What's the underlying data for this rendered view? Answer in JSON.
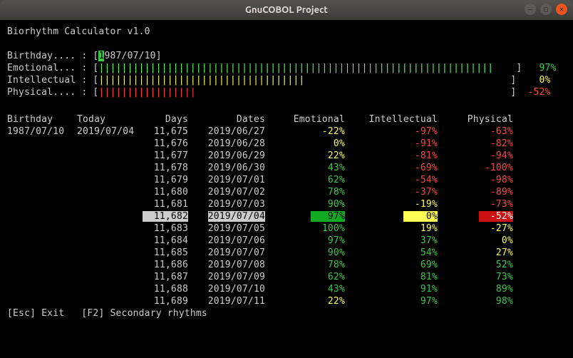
{
  "window": {
    "title": "GnuCOBOL Project"
  },
  "app": {
    "title": "Biorhythm Calculator v1.0"
  },
  "input": {
    "birthday_label": "Birthday.... : [",
    "birthday_cursor": "1",
    "birthday_rest": "987/07/10]"
  },
  "summary_bars": [
    {
      "label": "Emotional... : [",
      "color": "brightgreen",
      "count": 69,
      "close": " ]",
      "value": "97%",
      "valclass": "green"
    },
    {
      "label": "Intellectual : [",
      "color": "yellow",
      "count": 36,
      "close": "]",
      "value": "0%",
      "valclass": "yellow"
    },
    {
      "label": "Physical.... : [",
      "color": "red",
      "count": 17,
      "close": "]",
      "value": "-52%",
      "valclass": "red"
    }
  ],
  "headers": {
    "birthday": "Birthday",
    "today": "Today",
    "days": "Days",
    "dates": "Dates",
    "emotional": "Emotional",
    "intellectual": "Intellectual",
    "physical": "Physical"
  },
  "meta": {
    "birthday": "1987/07/10",
    "today": "2019/07/04"
  },
  "rows": [
    {
      "days": "11,675",
      "date": "2019/06/27",
      "emo": "-22%",
      "emo_cls": "yellow",
      "intel": "-97%",
      "intel_cls": "red",
      "phys": "-63%",
      "phys_cls": "red",
      "hl": false
    },
    {
      "days": "11,676",
      "date": "2019/06/28",
      "emo": "0%",
      "emo_cls": "yellow",
      "intel": "-91%",
      "intel_cls": "red",
      "phys": "-82%",
      "phys_cls": "red",
      "hl": false
    },
    {
      "days": "11,677",
      "date": "2019/06/29",
      "emo": "22%",
      "emo_cls": "yellow",
      "intel": "-81%",
      "intel_cls": "red",
      "phys": "-94%",
      "phys_cls": "red",
      "hl": false
    },
    {
      "days": "11,678",
      "date": "2019/06/30",
      "emo": "43%",
      "emo_cls": "green",
      "intel": "-69%",
      "intel_cls": "red",
      "phys": "-100%",
      "phys_cls": "red",
      "hl": false
    },
    {
      "days": "11,679",
      "date": "2019/07/01",
      "emo": "62%",
      "emo_cls": "green",
      "intel": "-54%",
      "intel_cls": "red",
      "phys": "-98%",
      "phys_cls": "red",
      "hl": false
    },
    {
      "days": "11,680",
      "date": "2019/07/02",
      "emo": "78%",
      "emo_cls": "green",
      "intel": "-37%",
      "intel_cls": "red",
      "phys": "-89%",
      "phys_cls": "red",
      "hl": false
    },
    {
      "days": "11,681",
      "date": "2019/07/03",
      "emo": "90%",
      "emo_cls": "green",
      "intel": "-19%",
      "intel_cls": "yellow",
      "phys": "-73%",
      "phys_cls": "red",
      "hl": false
    },
    {
      "days": "11,682",
      "date": "2019/07/04",
      "emo": "97%",
      "emo_cls": "bg-green",
      "intel": "0%",
      "intel_cls": "bg-yellow",
      "phys": "-52%",
      "phys_cls": "bg-red",
      "hl": true
    },
    {
      "days": "11,683",
      "date": "2019/07/05",
      "emo": "100%",
      "emo_cls": "green",
      "intel": "19%",
      "intel_cls": "yellow",
      "phys": "-27%",
      "phys_cls": "yellow",
      "hl": false
    },
    {
      "days": "11,684",
      "date": "2019/07/06",
      "emo": "97%",
      "emo_cls": "green",
      "intel": "37%",
      "intel_cls": "green",
      "phys": "0%",
      "phys_cls": "yellow",
      "hl": false
    },
    {
      "days": "11,685",
      "date": "2019/07/07",
      "emo": "90%",
      "emo_cls": "green",
      "intel": "54%",
      "intel_cls": "green",
      "phys": "27%",
      "phys_cls": "yellow",
      "hl": false
    },
    {
      "days": "11,686",
      "date": "2019/07/08",
      "emo": "78%",
      "emo_cls": "green",
      "intel": "69%",
      "intel_cls": "green",
      "phys": "52%",
      "phys_cls": "green",
      "hl": false
    },
    {
      "days": "11,687",
      "date": "2019/07/09",
      "emo": "62%",
      "emo_cls": "green",
      "intel": "81%",
      "intel_cls": "green",
      "phys": "73%",
      "phys_cls": "green",
      "hl": false
    },
    {
      "days": "11,688",
      "date": "2019/07/10",
      "emo": "43%",
      "emo_cls": "green",
      "intel": "91%",
      "intel_cls": "green",
      "phys": "89%",
      "phys_cls": "green",
      "hl": false
    },
    {
      "days": "11,689",
      "date": "2019/07/11",
      "emo": "22%",
      "emo_cls": "yellow",
      "intel": "97%",
      "intel_cls": "green",
      "phys": "98%",
      "phys_cls": "green",
      "hl": false
    }
  ],
  "footer": {
    "esc": "[Esc] Exit",
    "f2": "[F2] Secondary rhythms"
  },
  "colors": {
    "green": "#33cc44",
    "yellow": "#ffff55",
    "red": "#ff4444"
  }
}
